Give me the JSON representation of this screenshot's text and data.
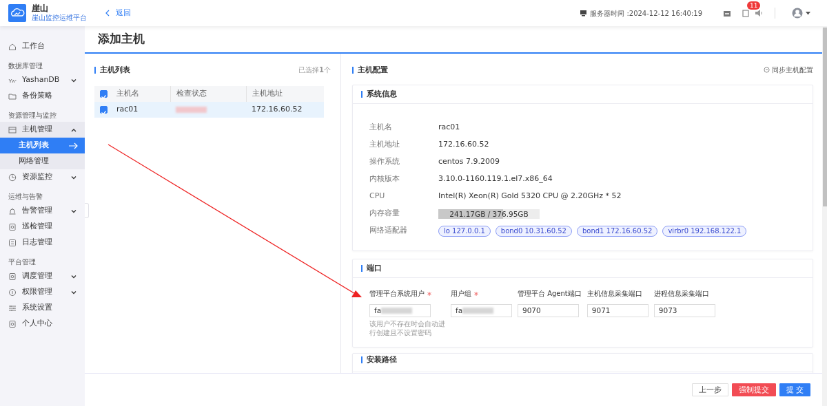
{
  "brand": {
    "name": "崖山",
    "subtitle": "崖山监控运维平台"
  },
  "back_link": "返回",
  "header": {
    "server_time": "服务器时间 :2024-12-12 16:40:19",
    "notification_count": "11"
  },
  "sidebar": [
    {
      "kind": "item",
      "label": "工作台",
      "selected": false
    },
    {
      "kind": "section",
      "label": "数据库管理"
    },
    {
      "kind": "item",
      "label": "YashanDB",
      "expanded": false,
      "selected": false
    },
    {
      "kind": "item",
      "label": "备份策略",
      "selected": false
    },
    {
      "kind": "section",
      "label": "资源管理与监控"
    },
    {
      "kind": "item",
      "label": "主机管理",
      "expanded": true,
      "selected": false
    },
    {
      "kind": "sub",
      "label": "主机列表",
      "selected": true
    },
    {
      "kind": "sub",
      "label": "网络管理",
      "selected": false
    },
    {
      "kind": "item",
      "label": "资源监控",
      "expanded": false,
      "selected": false
    },
    {
      "kind": "section",
      "label": "运维与告警"
    },
    {
      "kind": "item",
      "label": "告警管理",
      "expanded": false,
      "selected": false
    },
    {
      "kind": "item",
      "label": "巡检管理",
      "selected": false
    },
    {
      "kind": "item",
      "label": "日志管理",
      "selected": false
    },
    {
      "kind": "section",
      "label": "平台管理"
    },
    {
      "kind": "item",
      "label": "调度管理",
      "expanded": false,
      "selected": false
    },
    {
      "kind": "item",
      "label": "权限管理",
      "expanded": false,
      "selected": false
    },
    {
      "kind": "item",
      "label": "系统设置",
      "selected": false
    },
    {
      "kind": "item",
      "label": "个人中心",
      "selected": false
    }
  ],
  "page_title": "添加主机",
  "host_list": {
    "title": "主机列表",
    "selected_count": "已选择**1**个",
    "columns": [
      "主机名",
      "检查状态",
      "主机地址"
    ],
    "all_checked": true,
    "rows": [
      {
        "name": "rac01",
        "address": "172.16.60.52",
        "checked": true,
        "selected": true
      }
    ]
  },
  "host_config": {
    "title": "主机配置",
    "sync_link": "同步主机配置",
    "system_info": {
      "title": "系统信息",
      "fields": [
        {
          "kind": "text",
          "label": "主机名",
          "value": "rac01"
        },
        {
          "kind": "text",
          "label": "主机地址",
          "value": "172.16.60.52"
        },
        {
          "kind": "text",
          "label": "操作系统",
          "value": "centos 7.9.2009"
        },
        {
          "kind": "text",
          "label": "内核版本",
          "value": "3.10.0-1160.119.1.el7.x86_64"
        },
        {
          "kind": "text",
          "label": "CPU",
          "value": "Intel(R) Xeon(R) Gold 5320 CPU @ 2.20GHz * 52"
        },
        {
          "kind": "meter",
          "label": "内存容量",
          "value": "241.17GB / 376.95GB",
          "level": 0.64
        },
        {
          "kind": "tags",
          "label": "网络适配器",
          "tags": [
            "lo 127.0.0.1",
            "bond0 10.31.60.52",
            "bond1 172.16.60.52",
            "virbr0 192.168.122.1"
          ]
        }
      ]
    },
    "ports": {
      "title": "端口",
      "fields": [
        {
          "label": "管理平台系统用户",
          "required": true,
          "value": "fa",
          "hint": "该用户不存在时会自动进行创建且不设置密码"
        },
        {
          "label": "用户组",
          "required": true,
          "value": "fa"
        },
        {
          "label": "管理平台 Agent端口",
          "required": false,
          "value": "9070"
        },
        {
          "label": "主机信息采集端口",
          "required": false,
          "value": "9071"
        },
        {
          "label": "进程信息采集端口",
          "required": false,
          "value": "9073"
        }
      ]
    },
    "install_path": {
      "title": "安装路径"
    }
  },
  "footer_buttons": [
    {
      "kind": "default",
      "label": "上一步"
    },
    {
      "kind": "danger",
      "label": "强制提交"
    },
    {
      "kind": "primary",
      "label": "提 交"
    }
  ]
}
